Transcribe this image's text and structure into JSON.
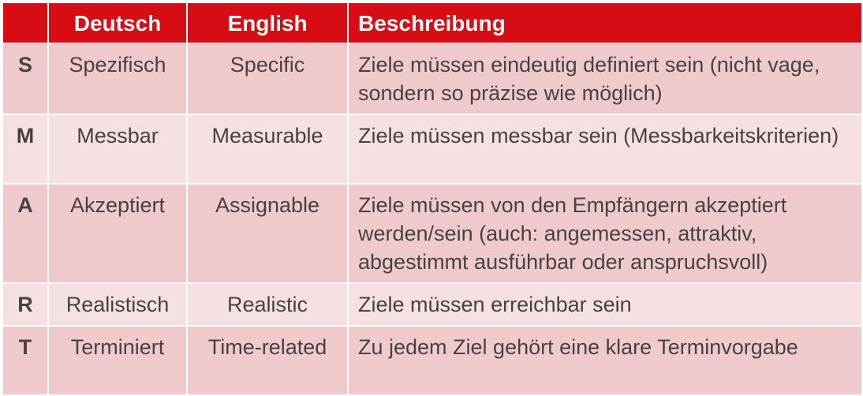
{
  "header": {
    "letter": "",
    "deutsch": "Deutsch",
    "english": "English",
    "beschreibung": "Beschreibung"
  },
  "rows": [
    {
      "letter": "S",
      "deutsch": "Spezifisch",
      "english": "Specific",
      "beschreibung": "Ziele müssen eindeutig definiert sein (nicht vage, sondern so präzise wie möglich)"
    },
    {
      "letter": "M",
      "deutsch": "Messbar",
      "english": "Measurable",
      "beschreibung": "Ziele müssen messbar sein (Messbarkeitskriterien)"
    },
    {
      "letter": "A",
      "deutsch": "Akzeptiert",
      "english": "Assignable",
      "beschreibung": "Ziele müssen von den Empfängern akzeptiert werden/sein (auch: angemessen, attraktiv, abgestimmt ausführbar oder anspruchsvoll)"
    },
    {
      "letter": "R",
      "deutsch": "Realistisch",
      "english": "Realistic",
      "beschreibung": "Ziele müssen erreichbar sein"
    },
    {
      "letter": "T",
      "deutsch": "Terminiert",
      "english": "Time-related",
      "beschreibung": "Zu jedem Ziel gehört eine klare Terminvorgabe"
    }
  ],
  "colors": {
    "header_bg": "#d70c14",
    "header_text": "#ffffff",
    "row_dark": "#efc9cb",
    "row_light": "#f6e1e2",
    "body_text": "#444444"
  }
}
